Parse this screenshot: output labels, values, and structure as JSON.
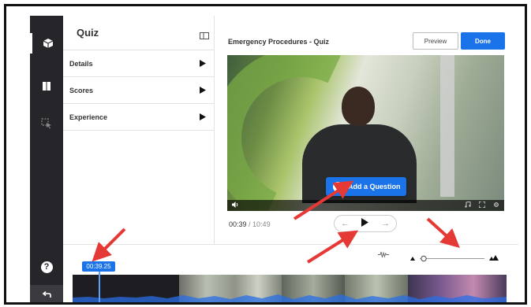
{
  "sidebar": {
    "help_label": "?",
    "items": [
      {
        "icon": "cube-icon",
        "active": true
      },
      {
        "icon": "book-icon",
        "active": false
      },
      {
        "icon": "cursor-select-icon",
        "active": false
      }
    ]
  },
  "panel": {
    "title": "Quiz",
    "rows": [
      {
        "label": "Details"
      },
      {
        "label": "Scores"
      },
      {
        "label": "Experience"
      }
    ]
  },
  "main": {
    "title": "Emergency Procedures - Quiz",
    "preview_label": "Preview",
    "done_label": "Done",
    "add_question_label": "Add a Question",
    "current_time": "00:39",
    "separator": " / ",
    "total_time": "10:49"
  },
  "timeline": {
    "playhead_time": "00:39.25"
  },
  "colors": {
    "accent": "#1a73e8",
    "sidebar": "#26262a",
    "annotation_arrow": "#e53935"
  }
}
